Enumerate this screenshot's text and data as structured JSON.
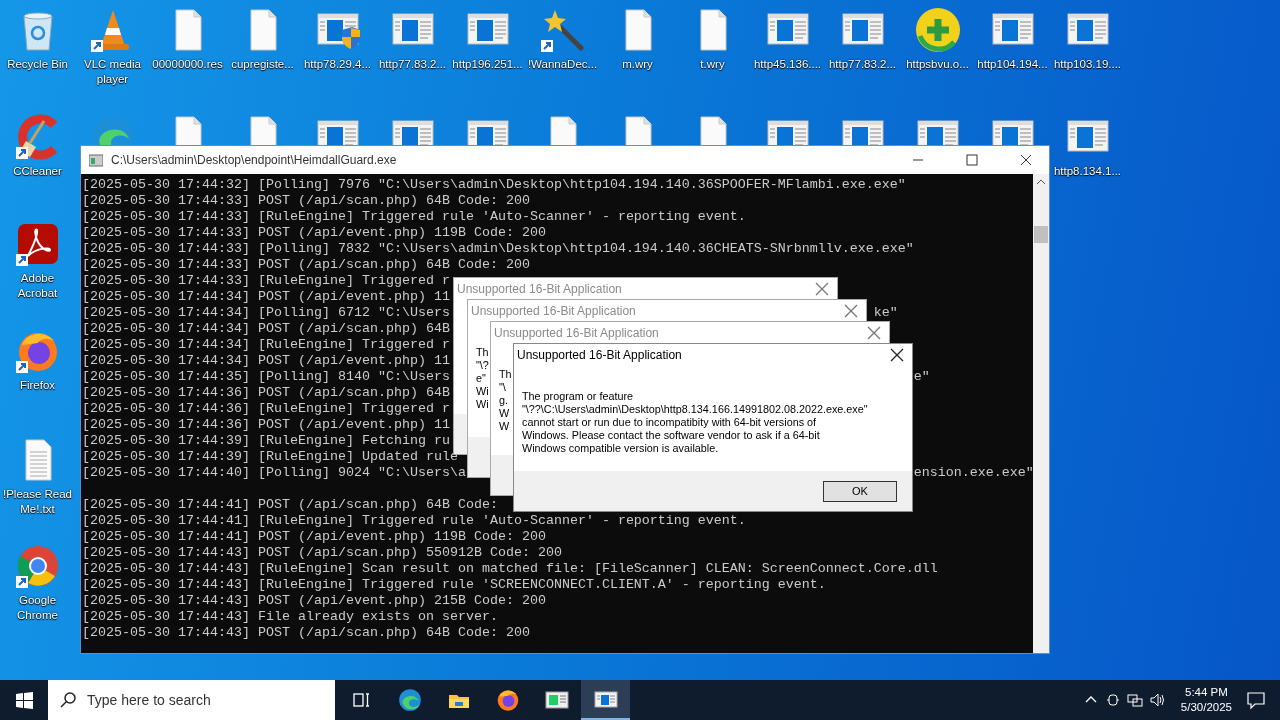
{
  "desktop": {
    "icons": [
      {
        "label": "Recycle Bin",
        "kind": "recycle"
      },
      {
        "label": "VLC media player",
        "kind": "vlc"
      },
      {
        "label": "00000000.res",
        "kind": "file"
      },
      {
        "label": "cupregiste...",
        "kind": "file"
      },
      {
        "label": "http78.29.4...",
        "kind": "exe-shield"
      },
      {
        "label": "http77.83.2...",
        "kind": "exe"
      },
      {
        "label": "http196.251...",
        "kind": "exe"
      },
      {
        "label": "!WannaDec...",
        "kind": "wand"
      },
      {
        "label": "m.wry",
        "kind": "file"
      },
      {
        "label": "t.wry",
        "kind": "file"
      },
      {
        "label": "http45.136....",
        "kind": "exe"
      },
      {
        "label": "http77.83.2...",
        "kind": "exe"
      },
      {
        "label": "httpsbvu.o...",
        "kind": "plus"
      },
      {
        "label": "http104.194...",
        "kind": "exe"
      },
      {
        "label": "http103.19....",
        "kind": "exe"
      },
      {
        "label": "CCleaner",
        "kind": "ccleaner"
      },
      {
        "kind": "edge"
      },
      {
        "kind": "file"
      },
      {
        "kind": "file"
      },
      {
        "kind": "exe"
      },
      {
        "kind": "exe"
      },
      {
        "kind": "exe"
      },
      {
        "kind": "file"
      },
      {
        "kind": "file"
      },
      {
        "kind": "file"
      },
      {
        "kind": "exe"
      },
      {
        "kind": "exe"
      },
      {
        "kind": "exe"
      },
      {
        "kind": "exe"
      },
      {
        "label": "http8.134.1...",
        "kind": "exe"
      },
      {
        "label": "Adobe Acrobat",
        "kind": "acrobat"
      },
      {
        "label": "Firefox",
        "kind": "firefox"
      },
      {
        "label": "!Please Read Me!.txt",
        "kind": "text"
      },
      {
        "label": "Google Chrome",
        "kind": "chrome"
      }
    ]
  },
  "console_window": {
    "title": "C:\\Users\\admin\\Desktop\\endpoint\\HeimdallGuard.exe",
    "lines": [
      {
        "text": "[2025-05-30 17:44:32] [Polling] 7976 \"C:\\Users\\admin\\Desktop\\http104.194.140.36SPOOFER-MFlambi.exe.exe\""
      },
      {
        "text": "[2025-05-30 17:44:33] POST (/api/scan.php) 64B Code: 200"
      },
      {
        "text": "[2025-05-30 17:44:33] [RuleEngine] Triggered rule 'Auto-Scanner' - reporting event."
      },
      {
        "text": "[2025-05-30 17:44:33] POST (/api/event.php) 119B Code: 200"
      },
      {
        "text": "[2025-05-30 17:44:33] [Polling] 7832 \"C:\\Users\\admin\\Desktop\\http104.194.140.36CHEATS-SNrbnmllv.exe.exe\""
      },
      {
        "text": "[2025-05-30 17:44:33] POST (/api/scan.php) 64B Code: 200"
      },
      {
        "text": "[2025-05-30 17:44:33] [RuleEngine] Triggered r"
      },
      {
        "text": "[2025-05-30 17:44:34] POST (/api/event.php) 11"
      },
      {
        "text": "[2025-05-30 17:44:34] [Polling] 6712 \"C:\\Users",
        "tail": "ke\""
      },
      {
        "text": "[2025-05-30 17:44:34] POST (/api/scan.php) 64B"
      },
      {
        "text": "[2025-05-30 17:44:34] [RuleEngine] Triggered r"
      },
      {
        "text": "[2025-05-30 17:44:34] POST (/api/event.php) 11"
      },
      {
        "text": "[2025-05-30 17:44:35] [Polling] 8140 \"C:\\Users",
        "tail": "e\""
      },
      {
        "text": "[2025-05-30 17:44:36] POST (/api/scan.php) 64B"
      },
      {
        "text": "[2025-05-30 17:44:36] [RuleEngine] Triggered r"
      },
      {
        "text": "[2025-05-30 17:44:36] POST (/api/event.php) 11"
      },
      {
        "text": "[2025-05-30 17:44:39] [RuleEngine] Fetching ru"
      },
      {
        "text": "[2025-05-30 17:44:39] [RuleEngine] Updated rule"
      },
      {
        "text": "[2025-05-30 17:44:40] [Polling] 9024 \"C:\\Users\\a",
        "tail": "ension.exe.exe\""
      },
      {
        "kind": "blank"
      },
      {
        "text": "[2025-05-30 17:44:41] POST (/api/scan.php) 64B Code:"
      },
      {
        "text": "[2025-05-30 17:44:41] [RuleEngine] Triggered rule 'Auto-Scanner' - reporting event."
      },
      {
        "text": "[2025-05-30 17:44:41] POST (/api/event.php) 119B Code: 200"
      },
      {
        "text": "[2025-05-30 17:44:43] POST (/api/scan.php) 550912B Code: 200"
      },
      {
        "text": "[2025-05-30 17:44:43] [RuleEngine] Scan result on matched file: [FileScanner] CLEAN: ScreenConnect.Core.dll"
      },
      {
        "text": "[2025-05-30 17:44:43] [RuleEngine] Triggered rule 'SCREENCONNECT.CLIENT.A' - reporting event."
      },
      {
        "text": "[2025-05-30 17:44:43] POST (/api/event.php) 215B Code: 200"
      },
      {
        "text": "[2025-05-30 17:44:43] File already exists on server."
      },
      {
        "text": "[2025-05-30 17:44:43] POST (/api/scan.php) 64B Code: 200"
      }
    ]
  },
  "dialogs": [
    {
      "title": "Unsupported 16-Bit Application",
      "active": false
    },
    {
      "title": "Unsupported 16-Bit Application",
      "active": false,
      "message": "Th\n\"\\?\ne\"\nWi\nWi"
    },
    {
      "title": "Unsupported 16-Bit Application",
      "active": false,
      "message": "Th\n\"\\\ng.\nW\nW"
    },
    {
      "title": "Unsupported 16-Bit Application",
      "active": true,
      "message": "The program or feature\n\"\\??\\C:\\Users\\admin\\Desktop\\http8.134.166.14991802.08.2022.exe.exe\"\ncannot start or run due to incompatibity with 64-bit versions of\nWindows. Please contact the software vendor to ask if a 64-bit\nWindows compatible version is available.",
      "button": "OK"
    }
  ],
  "taskbar": {
    "search": {
      "placeholder": "Type here to search"
    },
    "apps": [
      {
        "kind": "taskview",
        "selected": false
      },
      {
        "kind": "edge",
        "selected": false
      },
      {
        "kind": "explorer",
        "selected": false
      },
      {
        "kind": "firefox",
        "selected": false
      },
      {
        "kind": "app",
        "selected": false
      },
      {
        "kind": "console",
        "selected": true
      }
    ],
    "clock": {
      "time": "5:44 PM",
      "date": "5/30/2025"
    }
  }
}
